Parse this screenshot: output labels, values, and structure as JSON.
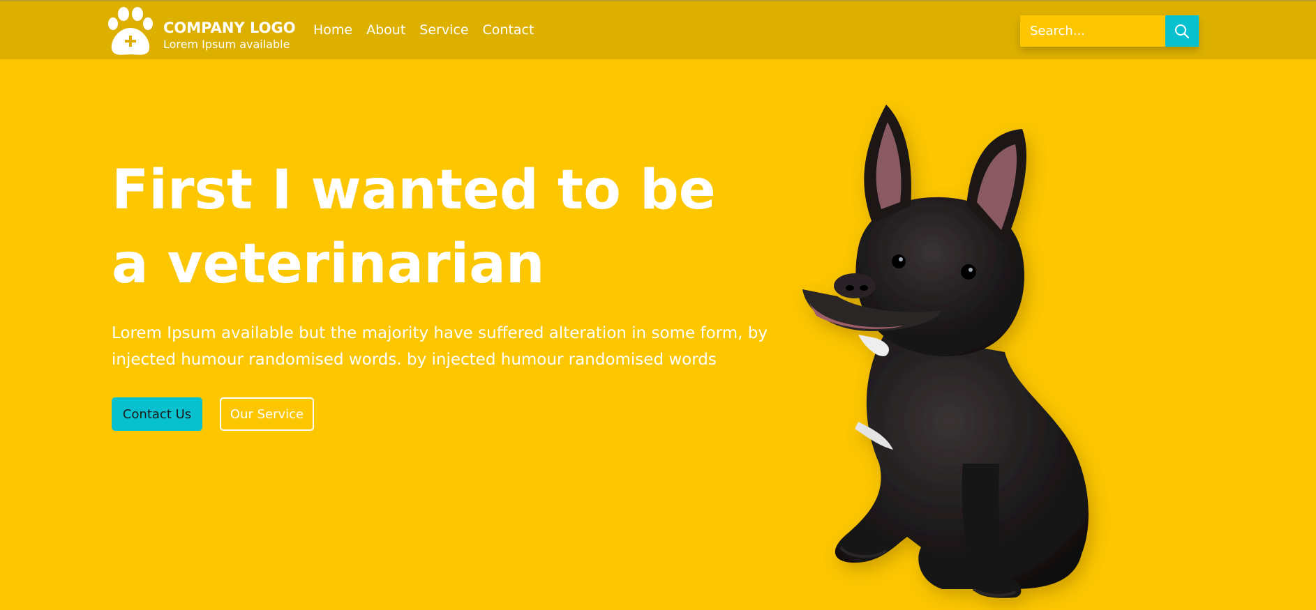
{
  "colors": {
    "page_background": "#fcc600",
    "header_background": "#ddb000",
    "accent_teal": "#07c1cf",
    "text_white": "#ffffff"
  },
  "header": {
    "logo": {
      "icon": "paw-plus-icon",
      "title": "COMPANY LOGO",
      "subtitle": "Lorem Ipsum available"
    },
    "nav": [
      {
        "label": "Home"
      },
      {
        "label": "About"
      },
      {
        "label": "Service"
      },
      {
        "label": "Contact"
      }
    ],
    "search": {
      "placeholder": "Search...",
      "value": "",
      "button_icon": "search-icon"
    }
  },
  "hero": {
    "title_lines": [
      "First I wanted to be",
      "a veterinarian"
    ],
    "lead_lines": [
      "Lorem Ipsum available but the majority have suffered alteration in some form, by",
      "injected humour randomised words. by injected humour randomised words"
    ],
    "primary_button": "Contact Us",
    "secondary_button": "Our Service",
    "image": "french-bulldog-photo"
  }
}
